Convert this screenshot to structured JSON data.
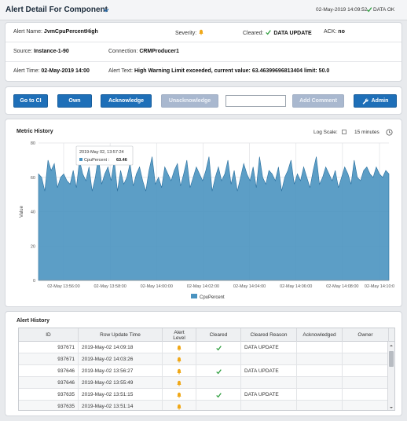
{
  "header": {
    "title": "Alert Detail For Component",
    "date": "02-May-2019 14:09:52",
    "status": "DATA OK",
    "colors": {
      "ok": "#2e9e3e"
    }
  },
  "info": {
    "alert_name_label": "Alert Name:",
    "alert_name": "JvmCpuPercentHigh",
    "severity_label": "Severity:",
    "severity_icon": "bell-icon",
    "cleared_label": "Cleared:",
    "cleared_value": "DATA UPDATE",
    "ack_label": "ACK:",
    "ack_value": "no",
    "source_label": "Source:",
    "source": "Instance-1-90",
    "connection_label": "Connection:",
    "connection": "CRMProducer1",
    "alert_time_label": "Alert Time:",
    "alert_time": "02-May-2019 14:00",
    "alert_text_label": "Alert Text:",
    "alert_text": "High Warning Limit exceeded, current value: 63.46399696813404 limit: 50.0"
  },
  "buttons": {
    "go_to_ci": "Go to CI",
    "own": "Own",
    "acknowledge": "Acknowledge",
    "unacknowledge": "Unacknowledge",
    "add_comment": "Add Comment",
    "admin": "Admin",
    "comment_value": "",
    "colors": {
      "primary": "#1e6fb8",
      "disabled": "#a9b8cf"
    }
  },
  "chart": {
    "title": "Metric History",
    "log_scale_label": "Log Scale:",
    "log_scale": false,
    "range_label": "15 minutes",
    "tooltip_time": "2019-May 02, 13:57:24",
    "tooltip_series": "CpuPercent :",
    "tooltip_value": "63.46"
  },
  "chart_data": {
    "type": "area",
    "title": "",
    "xlabel": "",
    "ylabel": "Value",
    "ylim": [
      0,
      80
    ],
    "yticks": [
      0,
      20,
      40,
      60,
      80
    ],
    "xticks": [
      "02-May 13:56:00",
      "02-May 13:58:00",
      "02-May 14:00:00",
      "02-May 14:02:00",
      "02-May 14:04:00",
      "02-May 14:06:00",
      "02-May 14:08:00",
      "02-May 14:10:0"
    ],
    "xlim_minutes": [
      0,
      15
    ],
    "grid": true,
    "legend": "bottom-center",
    "series": [
      {
        "name": "CpuPercent",
        "color": "#4a93c0",
        "values": [
          62,
          60,
          52,
          70,
          64,
          68,
          54,
          60,
          62,
          58,
          56,
          64,
          54,
          70,
          62,
          58,
          66,
          52,
          60,
          72,
          56,
          62,
          66,
          58,
          70,
          52,
          64,
          56,
          60,
          68,
          55,
          62,
          66,
          58,
          52,
          64,
          72,
          56,
          60,
          54,
          66,
          62,
          58,
          64,
          68,
          55,
          62,
          70,
          54,
          60,
          66,
          62,
          58,
          64,
          72,
          52,
          60,
          66,
          58,
          62,
          70,
          56,
          64,
          52,
          60,
          68,
          62,
          58,
          66,
          54,
          72,
          60,
          56,
          64,
          62,
          58,
          66,
          52,
          60,
          64,
          70,
          56,
          62,
          58,
          66,
          60,
          54,
          64,
          72,
          56,
          60,
          66,
          62,
          58,
          64,
          54,
          60,
          66,
          62,
          56,
          70,
          60,
          58,
          64,
          66,
          62,
          60,
          66,
          62,
          60,
          64,
          62
        ]
      }
    ]
  },
  "history": {
    "title": "Alert History",
    "columns": [
      "ID",
      "Row Update Time",
      "Alert Level",
      "Cleared",
      "Cleared Reason",
      "Acknowledged",
      "Owner"
    ],
    "rows": [
      {
        "id": "937671",
        "time": "2019-May-02 14:09:18",
        "level": "bell-icon",
        "cleared": true,
        "reason": "DATA UPDATE",
        "ack": "",
        "owner": ""
      },
      {
        "id": "937671",
        "time": "2019-May-02 14:03:26",
        "level": "bell-icon",
        "cleared": false,
        "reason": "",
        "ack": "",
        "owner": ""
      },
      {
        "id": "937646",
        "time": "2019-May-02 13:56:27",
        "level": "bell-icon",
        "cleared": true,
        "reason": "DATA UPDATE",
        "ack": "",
        "owner": ""
      },
      {
        "id": "937646",
        "time": "2019-May-02 13:55:49",
        "level": "bell-icon",
        "cleared": false,
        "reason": "",
        "ack": "",
        "owner": ""
      },
      {
        "id": "937635",
        "time": "2019-May-02 13:51:15",
        "level": "bell-icon",
        "cleared": true,
        "reason": "DATA UPDATE",
        "ack": "",
        "owner": ""
      },
      {
        "id": "937635",
        "time": "2019-May-02 13:51:14",
        "level": "bell-icon",
        "cleared": false,
        "reason": "",
        "ack": "",
        "owner": ""
      }
    ]
  }
}
